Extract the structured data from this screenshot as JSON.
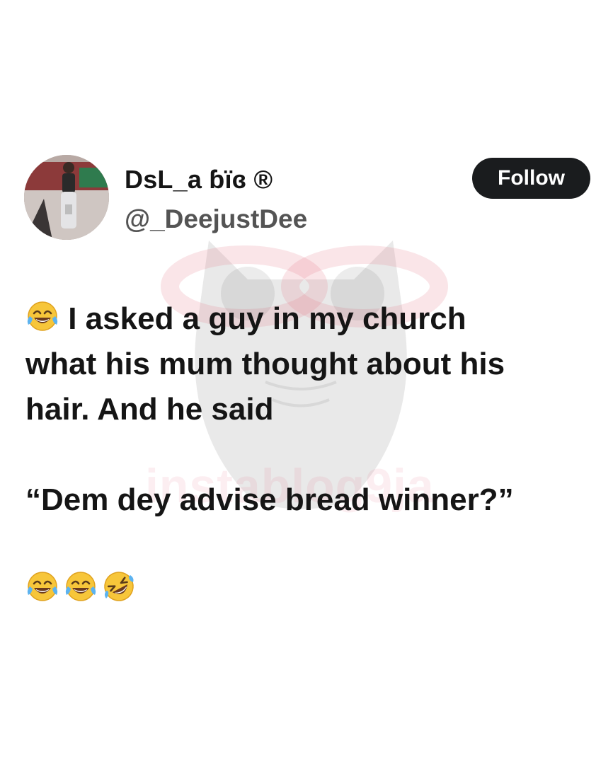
{
  "tweet": {
    "author": {
      "display_name": "DsL_a ɓïɞ ®",
      "handle": "@_DeejustDee",
      "avatar_icon": "profile-photo"
    },
    "follow_label": "Follow",
    "lines": [
      "I asked a guy in my church",
      "what his mum thought about his",
      "hair. And he said"
    ],
    "quote": "“Dem dey advise bread winner?”",
    "lead_emoji": "face-with-tears-of-joy-icon",
    "trailing_emojis": [
      "face-with-tears-of-joy-icon",
      "face-with-tears-of-joy-icon",
      "rolling-on-the-floor-laughing-icon"
    ]
  },
  "watermark": {
    "text": "instablog9ja",
    "icon": "owl-logo"
  },
  "colors": {
    "background": "#ffffff",
    "text": "#151515",
    "handle": "#545454",
    "button": "#1a1c1e",
    "button_text": "#ffffff"
  }
}
